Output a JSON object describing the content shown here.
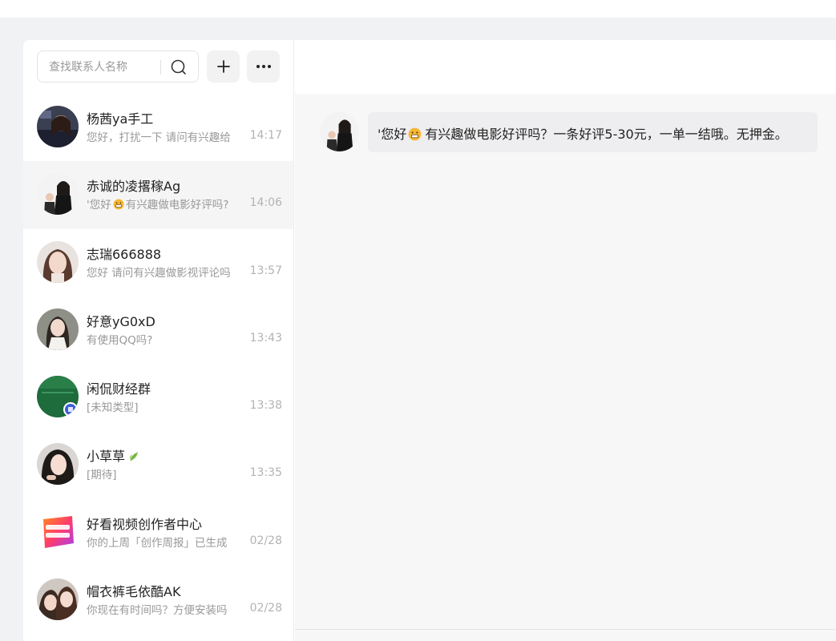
{
  "search": {
    "placeholder": "查找联系人名称"
  },
  "conversations": [
    {
      "name": "杨茜ya手工",
      "preview": "您好，打扰一下 请问有兴趣给",
      "time": "14:17",
      "active": false
    },
    {
      "name": "赤诚的凌撂稼Ag",
      "preview_before": "'您好",
      "preview_emoji": "grinning-emoji",
      "preview_after": "有兴趣做电影好评吗?",
      "time": "14:06",
      "active": true
    },
    {
      "name": "志瑞666888",
      "preview": "您好 请问有兴趣做影视评论吗",
      "time": "13:57",
      "active": false
    },
    {
      "name": "好意yG0xD",
      "preview": "有使用QQ吗?",
      "time": "13:43",
      "active": false
    },
    {
      "name": "闲侃财经群",
      "preview": "[未知类型]",
      "time": "13:38",
      "active": false
    },
    {
      "name": "小草草",
      "name_icon": "leaf-icon",
      "preview": "[期待]",
      "time": "13:35",
      "active": false
    },
    {
      "name": "好看视频创作者中心",
      "preview": "你的上周「创作周报」已生成",
      "time": "02/28",
      "active": false,
      "avatar_text": "好看视频创作者中心"
    },
    {
      "name": "帽衣裤毛依酷AK",
      "preview": "你现在有时间吗？方便安装吗",
      "time": "02/28",
      "active": false
    }
  ],
  "message": {
    "before": "'您好",
    "emoji": "grinning-emoji",
    "after": "有兴趣做电影好评吗？一条好评5-30元，一单一结哦。无押金。"
  },
  "colors": {
    "page_bg": "#f1f2f4",
    "active_row": "#f5f5f6",
    "bubble_bg": "#eeeef0",
    "muted_text": "#999999"
  }
}
